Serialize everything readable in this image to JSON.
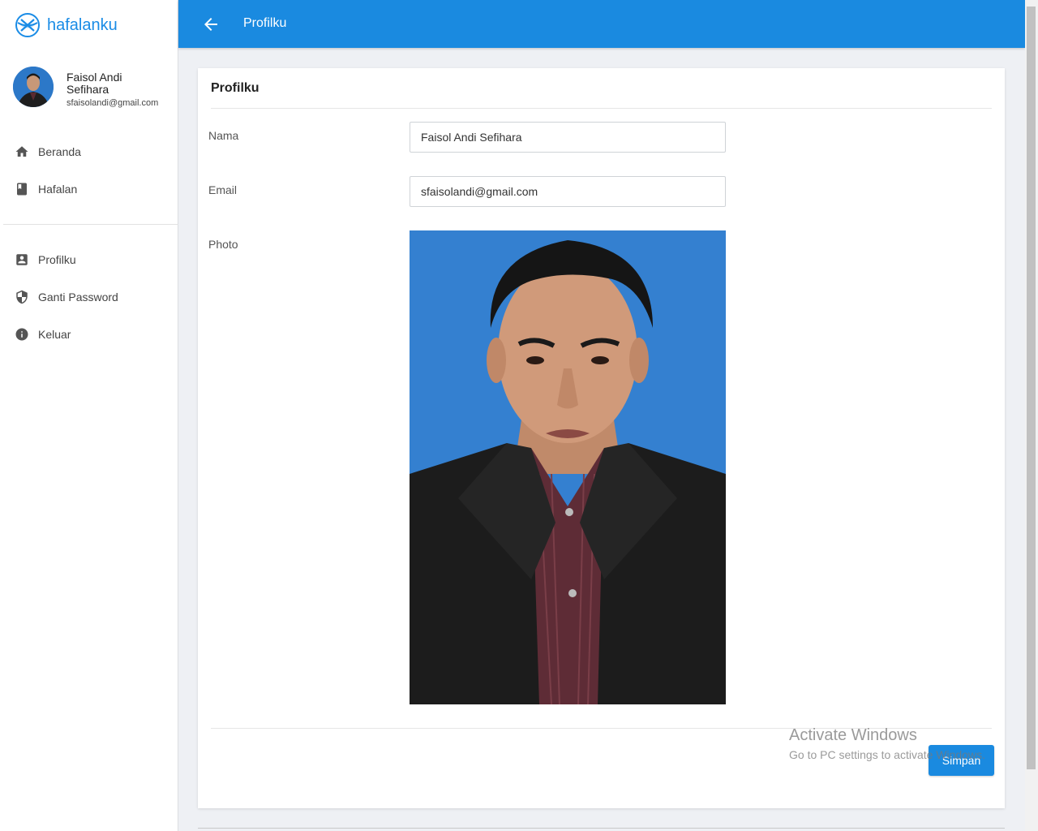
{
  "app": {
    "name": "hafalanku"
  },
  "user": {
    "name": "Faisol Andi Sefihara",
    "email": "sfaisolandi@gmail.com"
  },
  "nav": {
    "primary": [
      {
        "label": "Beranda",
        "icon": "home-icon"
      },
      {
        "label": "Hafalan",
        "icon": "book-icon"
      }
    ],
    "secondary": [
      {
        "label": "Profilku",
        "icon": "account-box-icon"
      },
      {
        "label": "Ganti Password",
        "icon": "shield-icon"
      },
      {
        "label": "Keluar",
        "icon": "info-icon"
      }
    ]
  },
  "topbar": {
    "title": "Profilku"
  },
  "card": {
    "title": "Profilku",
    "labels": {
      "name": "Nama",
      "email": "Email",
      "photo": "Photo"
    },
    "values": {
      "name": "Faisol Andi Sefihara",
      "email": "sfaisolandi@gmail.com"
    },
    "save_label": "Simpan"
  },
  "watermark": {
    "line1": "Activate Windows",
    "line2": "Go to PC settings to activate Windows."
  },
  "colors": {
    "primary": "#1a8ae0",
    "background": "#eef0f4"
  }
}
